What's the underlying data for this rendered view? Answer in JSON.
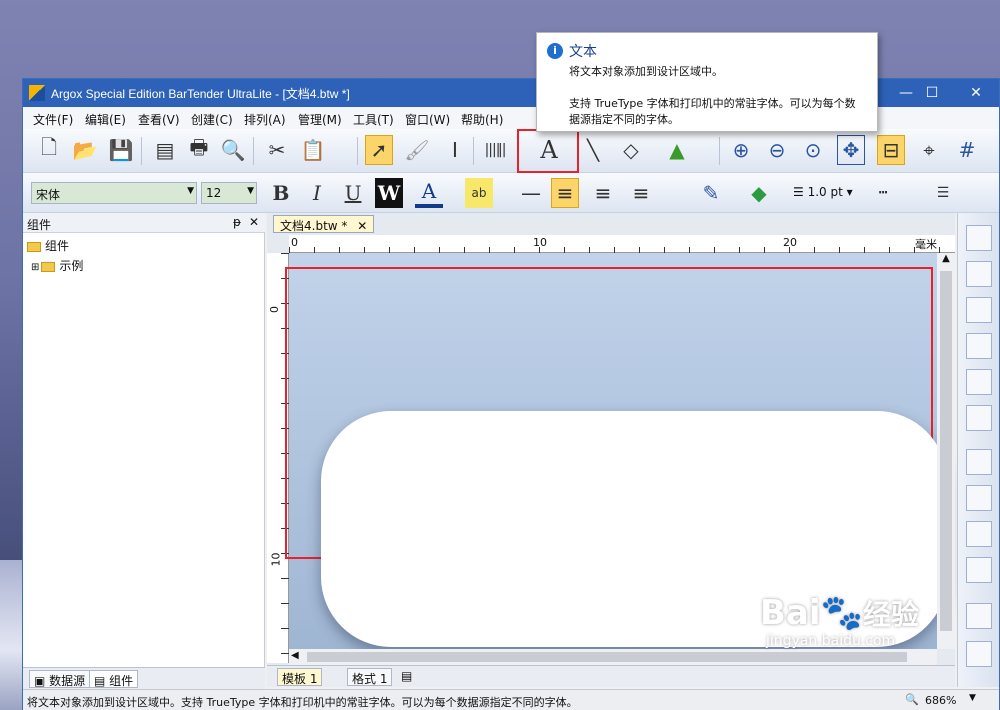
{
  "window": {
    "title": "Argox Special Edition BarTender UltraLite - [文档4.btw *]",
    "controls": [
      "—",
      "☐",
      "✕"
    ]
  },
  "menu": [
    "文件(F)",
    "编辑(E)",
    "查看(V)",
    "创建(C)",
    "排列(A)",
    "管理(M)",
    "工具(T)",
    "窗口(W)",
    "帮助(H)"
  ],
  "toolbar2": {
    "font": "宋体",
    "size": "12",
    "bold": "B",
    "italic": "I",
    "underline": "U",
    "word": "W",
    "font_color": "A",
    "highlight": "ab",
    "line_width": "1.0 pt"
  },
  "left_panel": {
    "title": "组件",
    "pin": "ᵽ",
    "close": "✕",
    "root": "组件",
    "child": "示例",
    "tabs": [
      "数据源",
      "组件"
    ]
  },
  "document": {
    "tab": "文档4.btw *",
    "tab_close": "✕",
    "ruler_h": [
      "0",
      "10",
      "20",
      "毫米"
    ],
    "ruler_v": [
      "0",
      "10"
    ],
    "sheet_tabs": [
      "模板 1",
      "格式 1"
    ]
  },
  "tooltip": {
    "title": "文本",
    "line1": "将文本对象添加到设计区域中。",
    "line2": "支持 TrueType 字体和打印机中的常驻字体。可以为每个数",
    "line3": "据源指定不同的字体。"
  },
  "status": {
    "text": "将文本对象添加到设计区域中。支持 TrueType 字体和打印机中的常驻字体。可以为每个数据源指定不同的字体。",
    "zoom": "686%"
  },
  "watermark": {
    "brand": "Bai",
    "brand2": "经验",
    "url": "jingyan.baidu.com"
  },
  "colors": {
    "titlebar": "#2e62b8",
    "highlight_red": "#e8222a",
    "active_button": "#fbd56a"
  }
}
